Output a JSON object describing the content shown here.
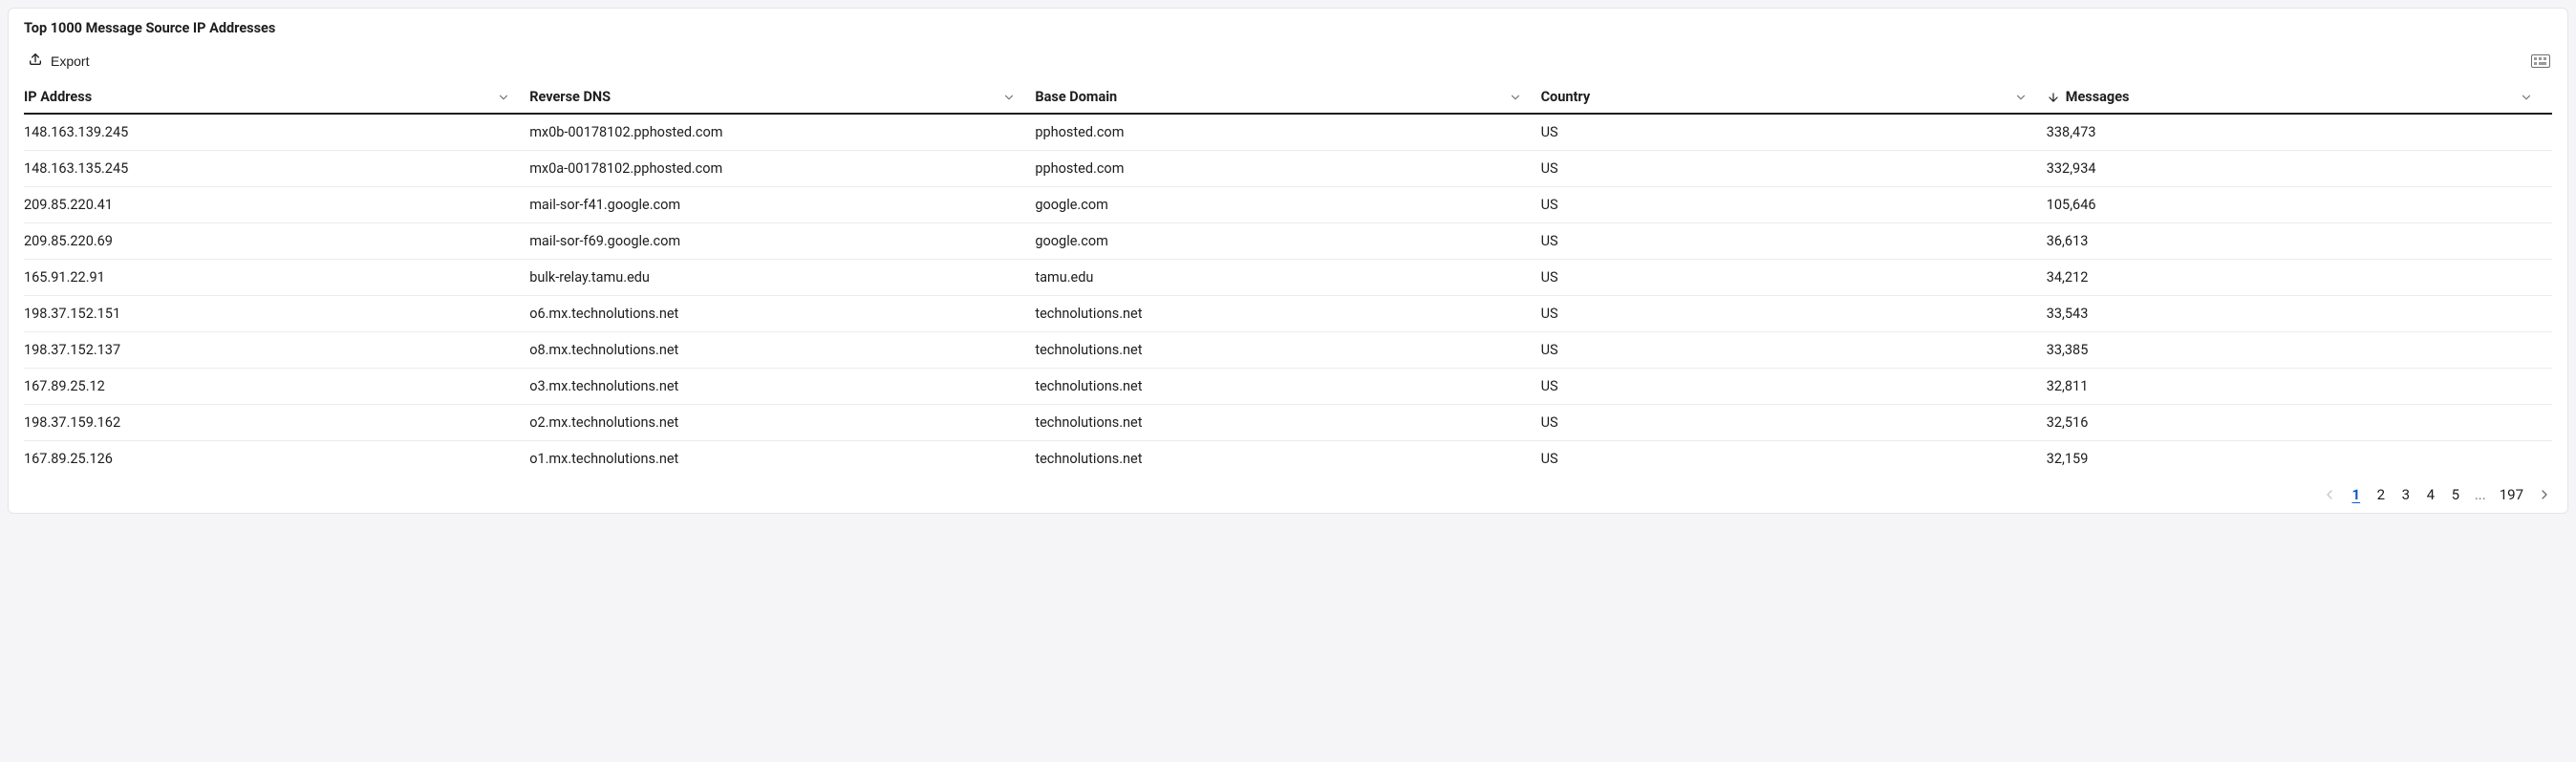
{
  "panel": {
    "title": "Top 1000 Message Source IP Addresses"
  },
  "toolbar": {
    "export_label": "Export"
  },
  "table": {
    "columns": {
      "ip": "IP Address",
      "rdns": "Reverse DNS",
      "domain": "Base Domain",
      "country": "Country",
      "messages": "Messages"
    },
    "sort": {
      "column": "messages",
      "direction": "desc"
    },
    "rows": [
      {
        "ip": "148.163.139.245",
        "rdns": "mx0b-00178102.pphosted.com",
        "domain": "pphosted.com",
        "country": "US",
        "messages": "338,473"
      },
      {
        "ip": "148.163.135.245",
        "rdns": "mx0a-00178102.pphosted.com",
        "domain": "pphosted.com",
        "country": "US",
        "messages": "332,934"
      },
      {
        "ip": "209.85.220.41",
        "rdns": "mail-sor-f41.google.com",
        "domain": "google.com",
        "country": "US",
        "messages": "105,646"
      },
      {
        "ip": "209.85.220.69",
        "rdns": "mail-sor-f69.google.com",
        "domain": "google.com",
        "country": "US",
        "messages": "36,613"
      },
      {
        "ip": "165.91.22.91",
        "rdns": "bulk-relay.tamu.edu",
        "domain": "tamu.edu",
        "country": "US",
        "messages": "34,212"
      },
      {
        "ip": "198.37.152.151",
        "rdns": "o6.mx.technolutions.net",
        "domain": "technolutions.net",
        "country": "US",
        "messages": "33,543"
      },
      {
        "ip": "198.37.152.137",
        "rdns": "o8.mx.technolutions.net",
        "domain": "technolutions.net",
        "country": "US",
        "messages": "33,385"
      },
      {
        "ip": "167.89.25.12",
        "rdns": "o3.mx.technolutions.net",
        "domain": "technolutions.net",
        "country": "US",
        "messages": "32,811"
      },
      {
        "ip": "198.37.159.162",
        "rdns": "o2.mx.technolutions.net",
        "domain": "technolutions.net",
        "country": "US",
        "messages": "32,516"
      },
      {
        "ip": "167.89.25.126",
        "rdns": "o1.mx.technolutions.net",
        "domain": "technolutions.net",
        "country": "US",
        "messages": "32,159"
      }
    ]
  },
  "pagination": {
    "pages_head": [
      "1",
      "2",
      "3",
      "4",
      "5"
    ],
    "ellipsis": "...",
    "last": "197",
    "current": "1"
  }
}
